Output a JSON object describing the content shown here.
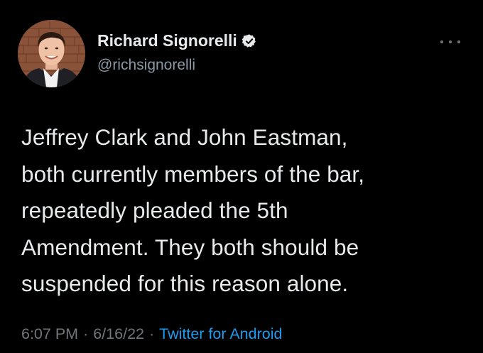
{
  "author": {
    "display_name": "Richard Signorelli",
    "handle": "@richsignorelli",
    "verified_icon": "verified-badge-icon",
    "avatar_icon": "profile-photo"
  },
  "tweet": {
    "lines": [
      "Jeffrey Clark and John Eastman,",
      "both currently members of the bar,",
      "repeatedly pleaded the 5th",
      "Amendment. They both should be",
      "suspended for this reason alone."
    ]
  },
  "meta": {
    "time": "6:07 PM",
    "separator": "·",
    "date": "6/16/22",
    "source": "Twitter for Android"
  },
  "menu": {
    "icon": "more-options-icon"
  },
  "colors": {
    "background": "#000000",
    "text": "#e7e9ea",
    "secondary": "#8b98a5",
    "link": "#1d9bf0"
  }
}
